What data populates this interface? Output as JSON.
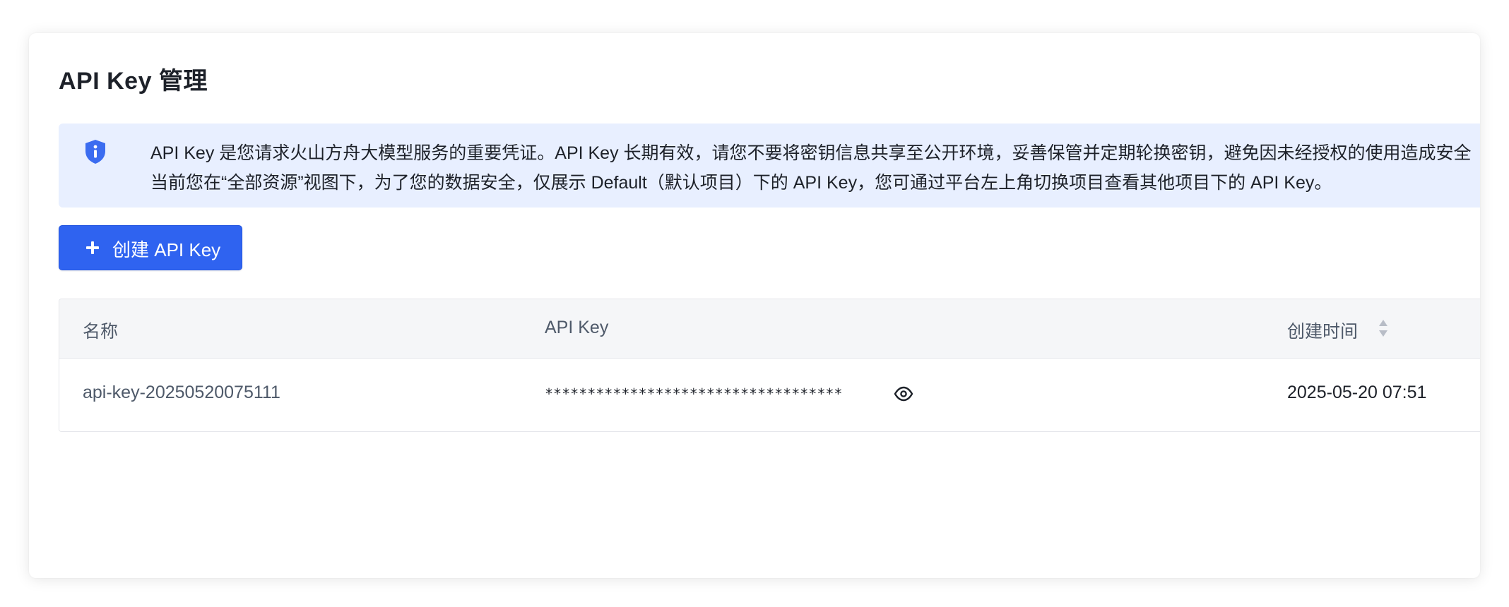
{
  "header": {
    "title": "API Key 管理"
  },
  "alert": {
    "icon": "shield-info-icon",
    "line1": "API Key 是您请求火山方舟大模型服务的重要凭证。API Key 长期有效，请您不要将密钥信息共享至公开环境，妥善保管并定期轮换密钥，避免因未经授权的使用造成安全",
    "line2": "当前您在“全部资源”视图下，为了您的数据安全，仅展示 Default（默认项目）下的 API Key，您可通过平台左上角切换项目查看其他项目下的 API Key。"
  },
  "actions": {
    "create_label": "创建 API Key"
  },
  "table": {
    "columns": [
      "名称",
      "API Key",
      "创建时间"
    ],
    "rows": [
      {
        "name": "api-key-20250520075111",
        "api_key": "***********************************",
        "created_at": "2025-05-20 07:51"
      }
    ]
  },
  "colors": {
    "primary": "#2f63f0",
    "alert_bg": "#e8efff",
    "header_bg": "#f5f6f8"
  }
}
